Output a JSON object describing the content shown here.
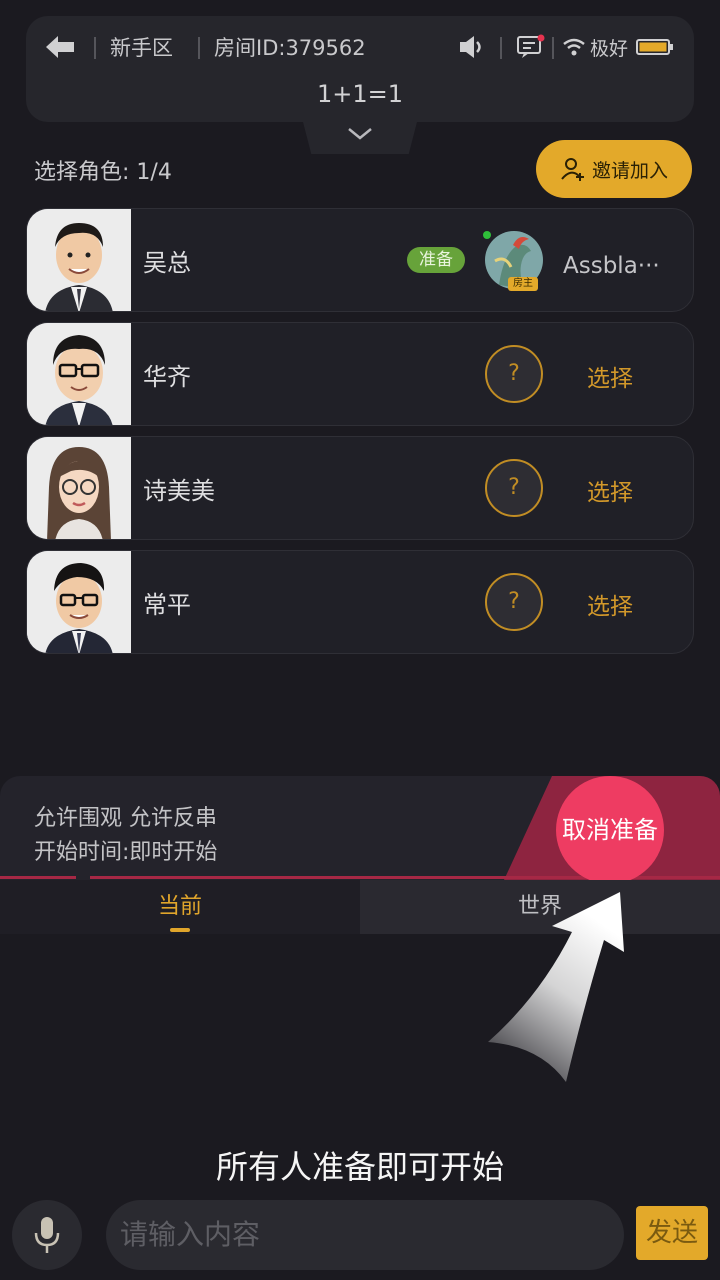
{
  "header": {
    "zone": "新手区",
    "room_id": "房间ID:379562",
    "room_name": "1+1=1",
    "network_label": "极好"
  },
  "select_label": "选择角色: 1/4",
  "invite_label": "邀请加入",
  "roles": [
    {
      "name": "吴总",
      "ready_tag": "准备",
      "player_name": "Assbla···",
      "host_tag": "房主"
    },
    {
      "name": "华齐",
      "slot_mark": "?",
      "action": "选择"
    },
    {
      "name": "诗美美",
      "slot_mark": "?",
      "action": "选择"
    },
    {
      "name": "常平",
      "slot_mark": "?",
      "action": "选择"
    }
  ],
  "info": {
    "rules": "允许围观 允许反串",
    "start_time": "开始时间:即时开始"
  },
  "cancel_ready_label": "取消准备",
  "tabs": [
    {
      "label": "当前"
    },
    {
      "label": "世界"
    }
  ],
  "hint": "所有人准备即可开始",
  "chat": {
    "placeholder": "请输入内容",
    "send_label": "发送"
  },
  "colors": {
    "accent": "#e3a92a",
    "ready_green": "#67a33a",
    "cancel_red": "#ee3c62"
  }
}
